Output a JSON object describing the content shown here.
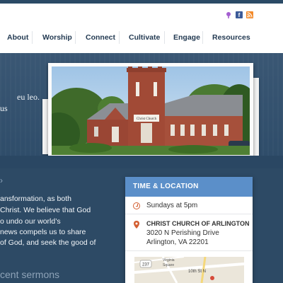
{
  "header": {
    "social": [
      {
        "name": "podcast-icon",
        "glyph": "◉"
      },
      {
        "name": "facebook-icon",
        "glyph": "f"
      },
      {
        "name": "rss-icon",
        "glyph": "◣"
      }
    ],
    "nav": [
      "About",
      "Worship",
      "Connect",
      "Cultivate",
      "Engage",
      "Resources"
    ]
  },
  "hero": {
    "lines": [
      "eu leo.",
      "us"
    ],
    "photo_sign": "Christ Church"
  },
  "main": {
    "arrow": "›",
    "body_lines": [
      "ansformation, as both",
      "Christ.  We believe that God",
      "o undo our world’s",
      "news compels us to share",
      "of God, and seek the good of"
    ],
    "sermons_heading": "cent sermons"
  },
  "card": {
    "title": "TIME & LOCATION",
    "time": "Sundays at 5pm",
    "church_name": "CHRIST CHURCH OF ARLINGTON",
    "address_line1": "3020 N Perishing Drive",
    "address_line2": "Arlington, VA 22201",
    "map_labels": {
      "road": "237",
      "street": "10th St N",
      "square": "Square",
      "area": "Virginia"
    }
  },
  "colors": {
    "accent": "#5b8fc9",
    "nav_text": "#233a52",
    "background": "#2d4a65",
    "icon_orange": "#d35f32"
  }
}
